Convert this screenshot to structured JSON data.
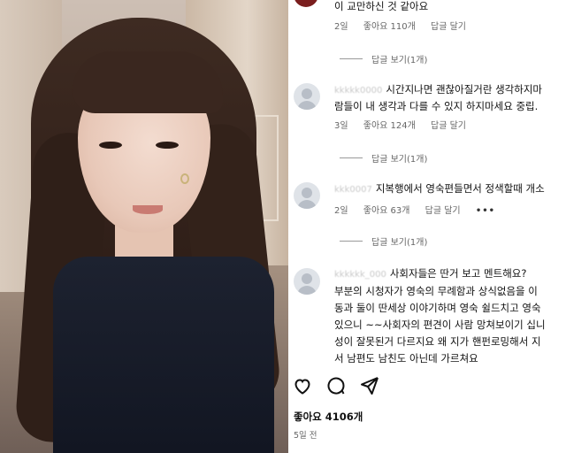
{
  "post": {
    "likes_label": "좋아요 4106개",
    "date_label": "5일 전"
  },
  "comments": [
    {
      "username": "",
      "lines": [
        "이 교만하신 것 같아요"
      ],
      "age": "2일",
      "likes": "좋아요 110개",
      "reply": "답글 달기",
      "view_replies": "답글 보기(1개)"
    },
    {
      "username": "kkkkk0000",
      "lines": [
        "시간지나면 괜찮아질거란 생각하지마",
        "람들이 내 생각과 다를 수 있지 하지마세요 중립."
      ],
      "age": "3일",
      "likes": "좋아요 124개",
      "reply": "답글 달기",
      "view_replies": "답글 보기(1개)"
    },
    {
      "username": "kkk0007",
      "lines": [
        "지복행에서 영숙편들면서 정색할때 개소"
      ],
      "age": "2일",
      "likes": "좋아요 63개",
      "reply": "답글 달기",
      "more": "•••",
      "view_replies": "답글 보기(1개)"
    },
    {
      "username": "kkkkkk_000",
      "lines": [
        "사회자들은 딴거 보고 멘트해요?",
        "부분의 시청자가 영숙의 무례함과 상식없음을 이",
        "동과 둘이 딴세상 이야기하며 영숙 쉴드치고 영숙",
        "있으니 ~~사회자의 편견이 사람 망쳐보이기 십니",
        "성이 잘못된거 다르지요 왜 지가 핸펀로밍해서 지",
        "서 남편도 남친도 아닌데 가르쳐요"
      ]
    }
  ],
  "icons": [
    "heart-icon",
    "comment-icon",
    "share-icon"
  ]
}
